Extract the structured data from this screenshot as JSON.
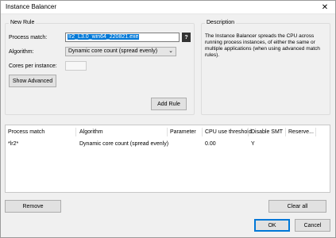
{
  "window": {
    "title": "Instance Balancer",
    "close_glyph": "✕"
  },
  "new_rule": {
    "group_label": "New Rule",
    "process_match_label": "Process match:",
    "process_match_value": "Ir2_L3.0_win64_220821.exe",
    "help_glyph": "?",
    "algorithm_label": "Algorithm:",
    "algorithm_value": "Dynamic core count (spread evenly)",
    "cores_label": "Cores per instance:",
    "cores_value": "",
    "show_advanced_label": "Show Advanced",
    "add_rule_label": "Add Rule"
  },
  "description": {
    "group_label": "Description",
    "text": "The Instance Balancer spreads the CPU across running process instances, of either the same or multiple applications (when using advanced match rules)."
  },
  "table": {
    "columns": [
      "Process match",
      "Algorithm",
      "Parameter",
      "CPU use threshold",
      "Disable SMT",
      "Reserve..."
    ],
    "rows": [
      [
        "*lr2*",
        "Dynamic core count (spread evenly)",
        "",
        "0.00",
        "Y",
        ""
      ]
    ]
  },
  "buttons": {
    "remove": "Remove",
    "clear_all": "Clear all",
    "ok": "OK",
    "cancel": "Cancel"
  }
}
